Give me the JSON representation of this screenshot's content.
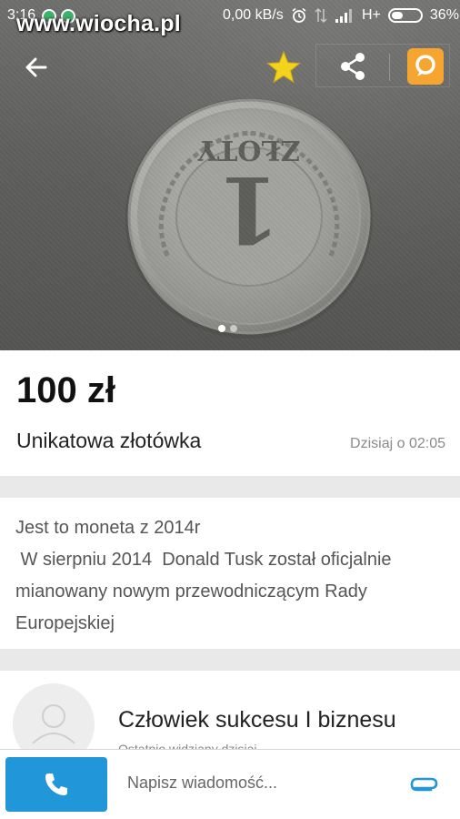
{
  "status_bar": {
    "time": "3:16",
    "watermark": "www.wiocha.pl",
    "speed": "0,00 kB/s",
    "network": "H+",
    "battery": "36%"
  },
  "photo": {
    "subject": "coin",
    "coin_text": "ZŁOTY",
    "coin_numeral": "1",
    "page_count": 2,
    "active_page": 1
  },
  "listing": {
    "price": "100 zł",
    "title": "Unikatowa złotówka",
    "date": "Dzisiaj o 02:05"
  },
  "description": {
    "lines": [
      "Jest to moneta z 2014r",
      " W sierpniu 2014  Donald Tusk został oficjalnie",
      "mianowany nowym przewodniczącym Rady",
      "Europejskiej"
    ]
  },
  "seller": {
    "name": "Człowiek sukcesu I biznesu",
    "last_seen": "Ostatnio widziany dzisiaj"
  },
  "bottom_bar": {
    "message_placeholder": "Napisz wiadomość..."
  },
  "colors": {
    "accent_blue": "#2196d9",
    "accent_orange": "#f7a531",
    "star_yellow": "#f5d31c"
  },
  "icons": [
    "back-arrow-icon",
    "star-icon",
    "share-icon",
    "orange-chat-icon",
    "phone-icon",
    "attach-icon",
    "avatar-placeholder-icon"
  ]
}
